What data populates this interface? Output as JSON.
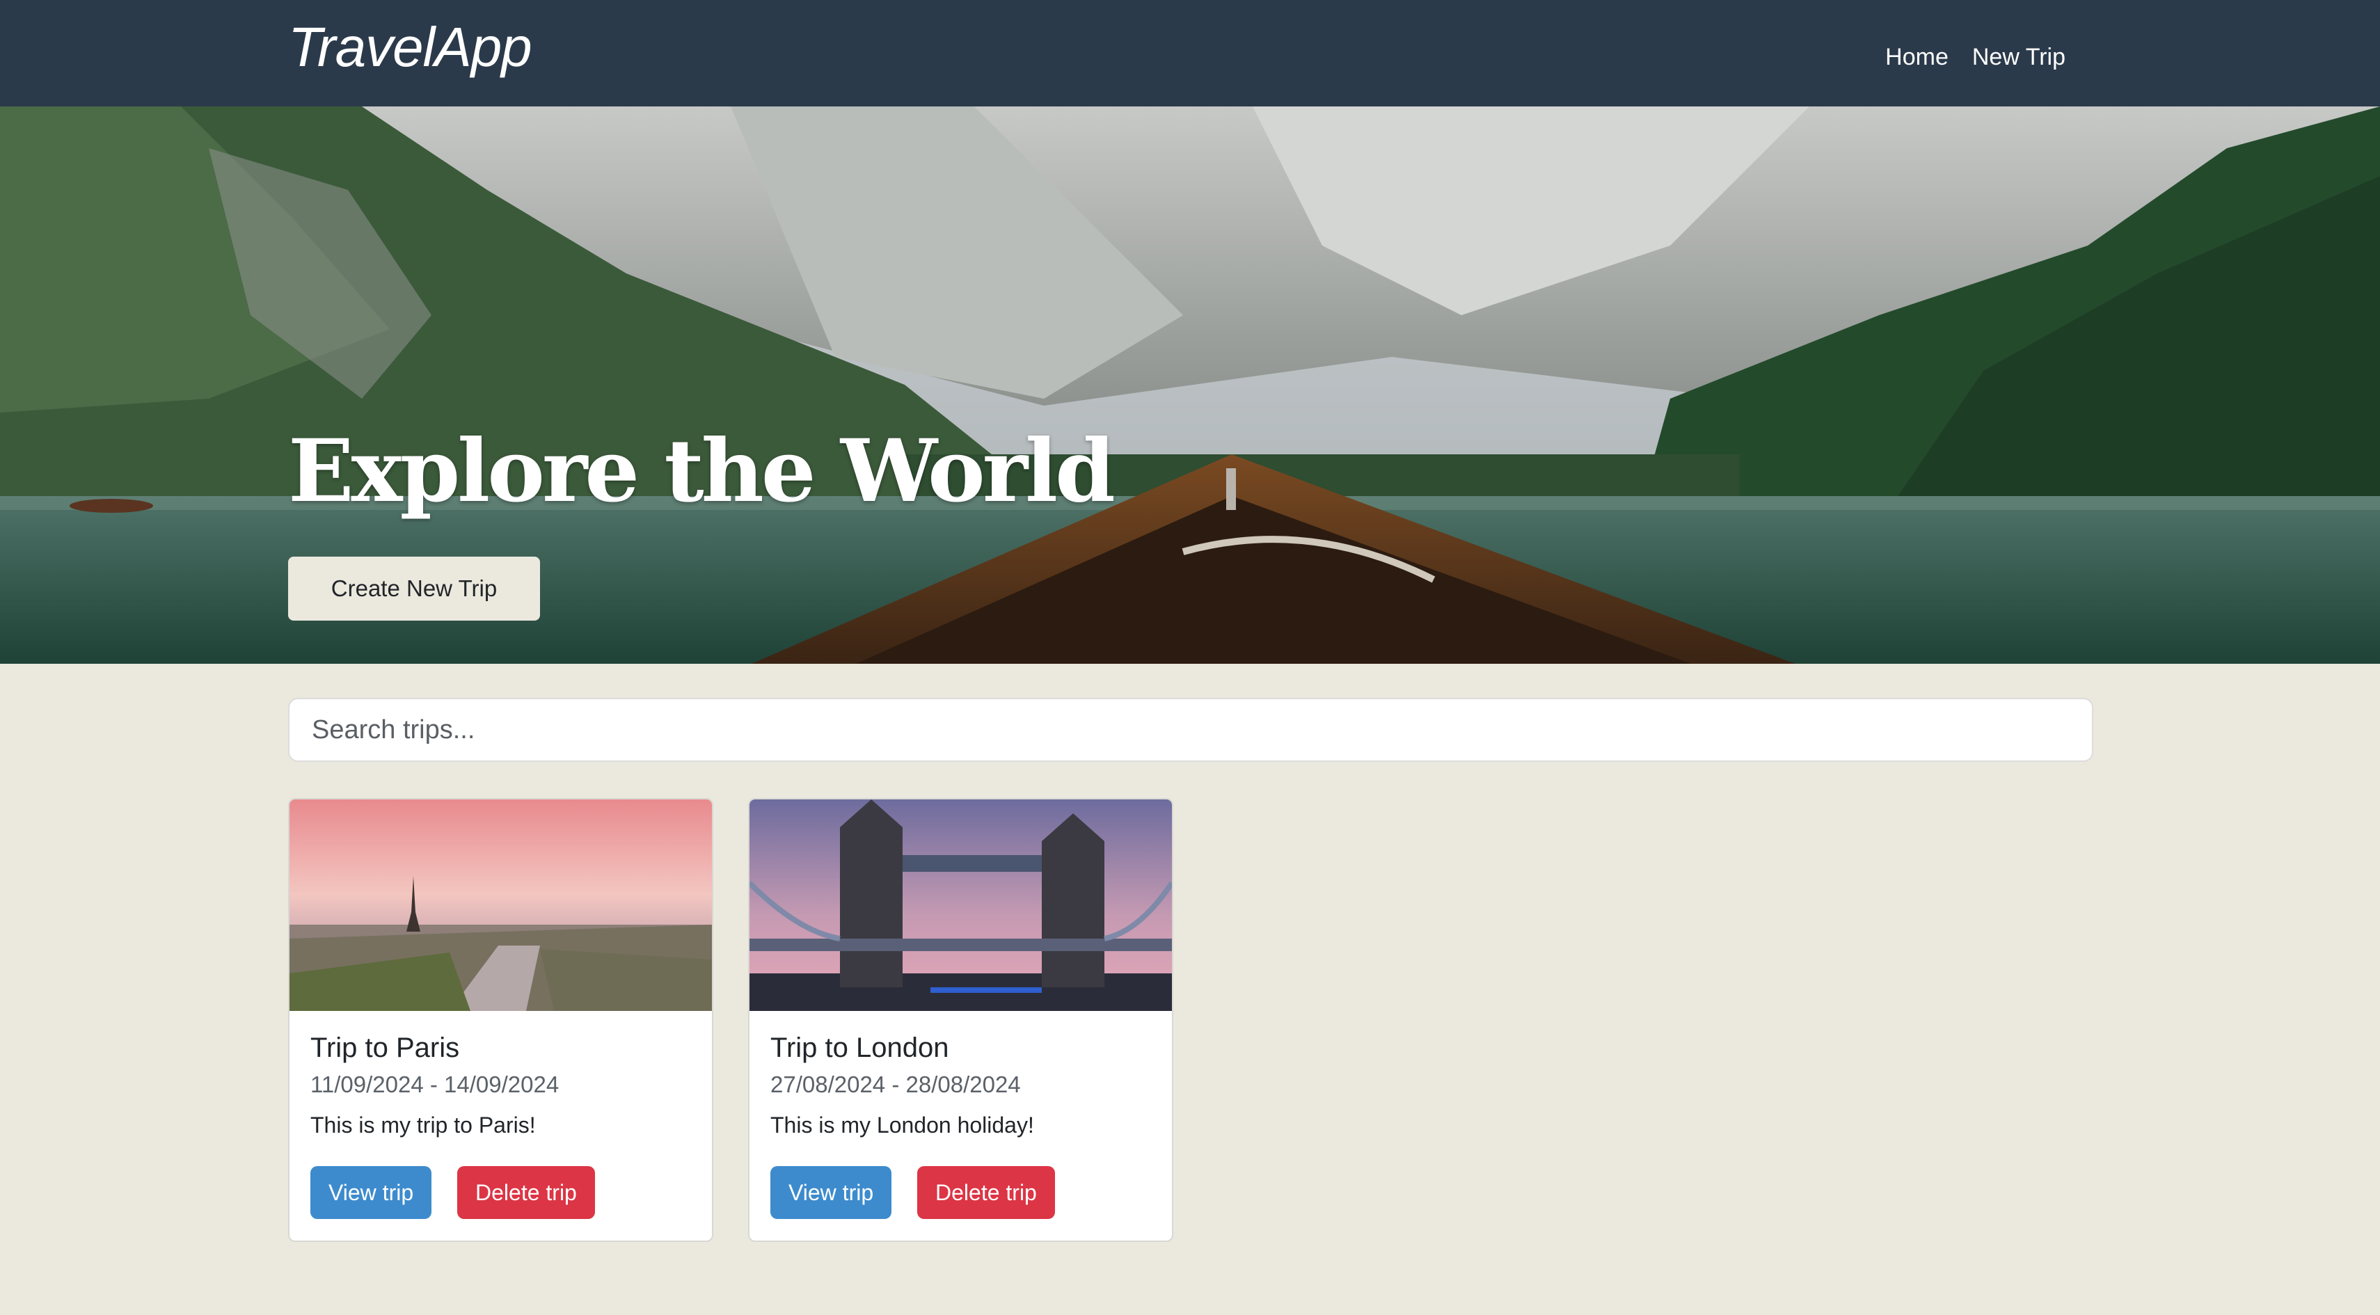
{
  "navbar": {
    "brand": "TravelApp",
    "links": [
      "Home",
      "New Trip"
    ]
  },
  "hero": {
    "title": "Explore the World",
    "button_label": "Create New Trip"
  },
  "search": {
    "placeholder": "Search trips..."
  },
  "trips": [
    {
      "title": "Trip to Paris",
      "dates": "11/09/2024 - 14/09/2024",
      "description": "This is my trip to Paris!",
      "view_label": "View trip",
      "delete_label": "Delete trip"
    },
    {
      "title": "Trip to London",
      "dates": "27/08/2024 - 28/08/2024",
      "description": "This is my London holiday!",
      "view_label": "View trip",
      "delete_label": "Delete trip"
    }
  ],
  "colors": {
    "navbar": "#2b3a4a",
    "page_background": "#ebe8dd",
    "view_button": "#3d8bcd",
    "delete_button": "#dc3545"
  }
}
